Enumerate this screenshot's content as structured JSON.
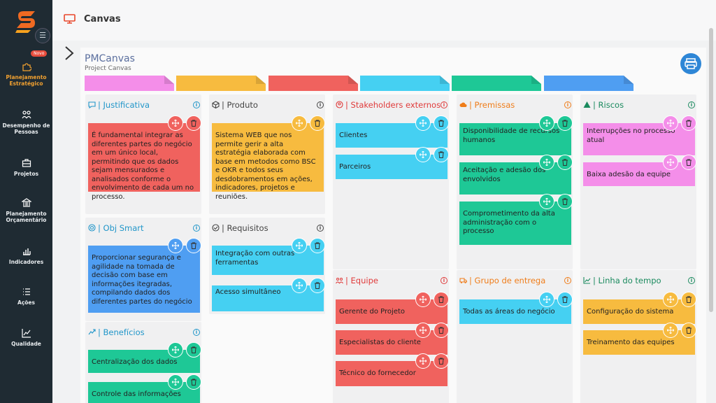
{
  "sidebar": {
    "badge": "Novo",
    "items": [
      {
        "label": "Planejamento Estratégico",
        "icon": "puzzle-icon"
      },
      {
        "label": "Desempenho de Pessoas",
        "icon": "people-icon"
      },
      {
        "label": "Projetos",
        "icon": "briefcase-icon"
      },
      {
        "label": "Planejamento Orçamentário",
        "icon": "bank-icon"
      },
      {
        "label": "Indicadores",
        "icon": "bar-chart-icon"
      },
      {
        "label": "Ações",
        "icon": "list-icon"
      },
      {
        "label": "Qualidade",
        "icon": "line-chart-icon"
      }
    ]
  },
  "header": {
    "title": "Canvas",
    "icon": "monitor-icon"
  },
  "canvas": {
    "title": "PMCanvas",
    "subtitle": "Project Canvas"
  },
  "colors": {
    "red": "#f0625e",
    "yellow": "#f7bb3f",
    "blue": "#4f9ef2",
    "cyan": "#45d0f2",
    "green": "#1ec896",
    "pink": "#f48ee9",
    "tabs": [
      "#f48ee9",
      "#f7bb3f",
      "#f0625e",
      "#45d0f2",
      "#1ec896",
      "#4f9ef2"
    ]
  },
  "columns": {
    "justificativa": {
      "label": "| Justificativa",
      "icon": "chat-icon",
      "color": "#2196c9",
      "notes": [
        "É fundamental integrar as diferentes partes do negócio em um único local, permitindo que os dados sejam mensurados e analisados conforme o envolvimento de cada um no processo."
      ]
    },
    "obj_smart": {
      "label": "| Obj Smart",
      "icon": "target-icon",
      "color": "#2196c9",
      "notes": [
        "Proporcionar segurança e agilidade na tomada de decisão com base em informações itegradas, compilando dados dos diferentes partes do negócio"
      ]
    },
    "beneficios": {
      "label": "| Benefícios",
      "icon": "trend-icon",
      "color": "#2196c9",
      "notes": [
        "Centralização dos dados",
        "Controle das informações"
      ]
    },
    "produto": {
      "label": "| Produto",
      "icon": "box-icon",
      "color": "#444444",
      "notes": [
        "Sistema WEB que nos permite gerir a alta estratégia elaborada com base em metodos como BSC e OKR e todos seus desdobramentos em ações, indicadores, projetos e reuniões."
      ]
    },
    "requisitos": {
      "label": "| Requisitos",
      "icon": "check-circle-icon",
      "color": "#444444",
      "notes": [
        "Integração com outras ferramentas",
        "Acesso simultâneo"
      ]
    },
    "stakeholders": {
      "label": "| Stakeholders externos",
      "icon": "user-circle-icon",
      "color": "#e03b3b",
      "notes": [
        "Clientes",
        "Parceiros"
      ]
    },
    "equipe": {
      "label": "| Equipe",
      "icon": "team-icon",
      "color": "#e03b3b",
      "notes": [
        "Gerente do Projeto",
        "Especialistas do cliente",
        "Técnico do fornecedor"
      ]
    },
    "premissas": {
      "label": "| Premissas",
      "icon": "cloud-icon",
      "color": "#ef7d1a",
      "notes": [
        "Disponibilidade de recursos humanos",
        "Aceitação e adesão dos envolvidos",
        "Comprometimento da alta administração com o processo"
      ]
    },
    "grupo_entrega": {
      "label": "| Grupo de entrega",
      "icon": "truck-icon",
      "color": "#ef7d1a",
      "notes": [
        "Todas as áreas do negócio"
      ]
    },
    "riscos": {
      "label": "| Riscos",
      "icon": "warning-icon",
      "color": "#1a8a5e",
      "notes": [
        "Interrupções no processo atual",
        "Baixa adesão da equipe"
      ]
    },
    "linha_tempo": {
      "label": "| Linha do tempo",
      "icon": "chart-line-icon",
      "color": "#1a8a5e",
      "notes": [
        "Configuração do sistema",
        "Treinamento das equipes"
      ]
    }
  }
}
